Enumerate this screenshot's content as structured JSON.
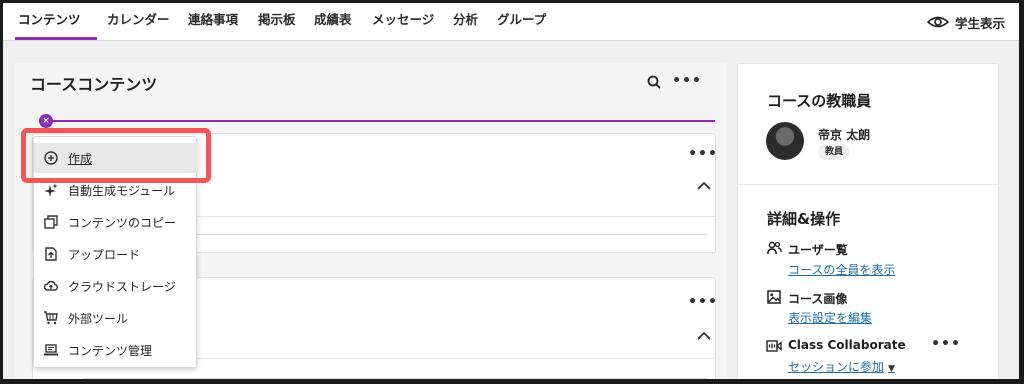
{
  "nav": {
    "tabs": [
      "コンテンツ",
      "カレンダー",
      "連絡事項",
      "掲示板",
      "成績表",
      "メッセージ",
      "分析",
      "グループ"
    ],
    "active_tab": "コンテンツ",
    "student_view_label": "学生表示"
  },
  "content": {
    "title": "コースコンテンツ",
    "search_icon": "search-icon",
    "more_icon": "more-icon"
  },
  "create_menu": {
    "items": [
      {
        "label": "作成",
        "icon": "plus-circle-icon"
      },
      {
        "label": "自動生成モジュール",
        "icon": "sparkle-icon"
      },
      {
        "label": "コンテンツのコピー",
        "icon": "copy-icon"
      },
      {
        "label": "アップロード",
        "icon": "upload-icon"
      },
      {
        "label": "クラウドストレージ",
        "icon": "cloud-icon"
      },
      {
        "label": "外部ツール",
        "icon": "cart-icon"
      },
      {
        "label": "コンテンツ管理",
        "icon": "laptop-icon"
      }
    ]
  },
  "sidebar": {
    "faculty_title": "コースの教職員",
    "instructor_name": "帝京 太朗",
    "instructor_role": "教員",
    "details_title": "詳細&操作",
    "roster_title": "ユーザー覧",
    "roster_link": "コースの全員を表示",
    "image_title": "コース画像",
    "image_link": "表示設定を編集",
    "collab_title": "Class Collaborate",
    "collab_link": "セッションに参加"
  },
  "colors": {
    "accent": "#8a2fb0",
    "highlight": "#f0565a",
    "link": "#1f6ea8"
  }
}
